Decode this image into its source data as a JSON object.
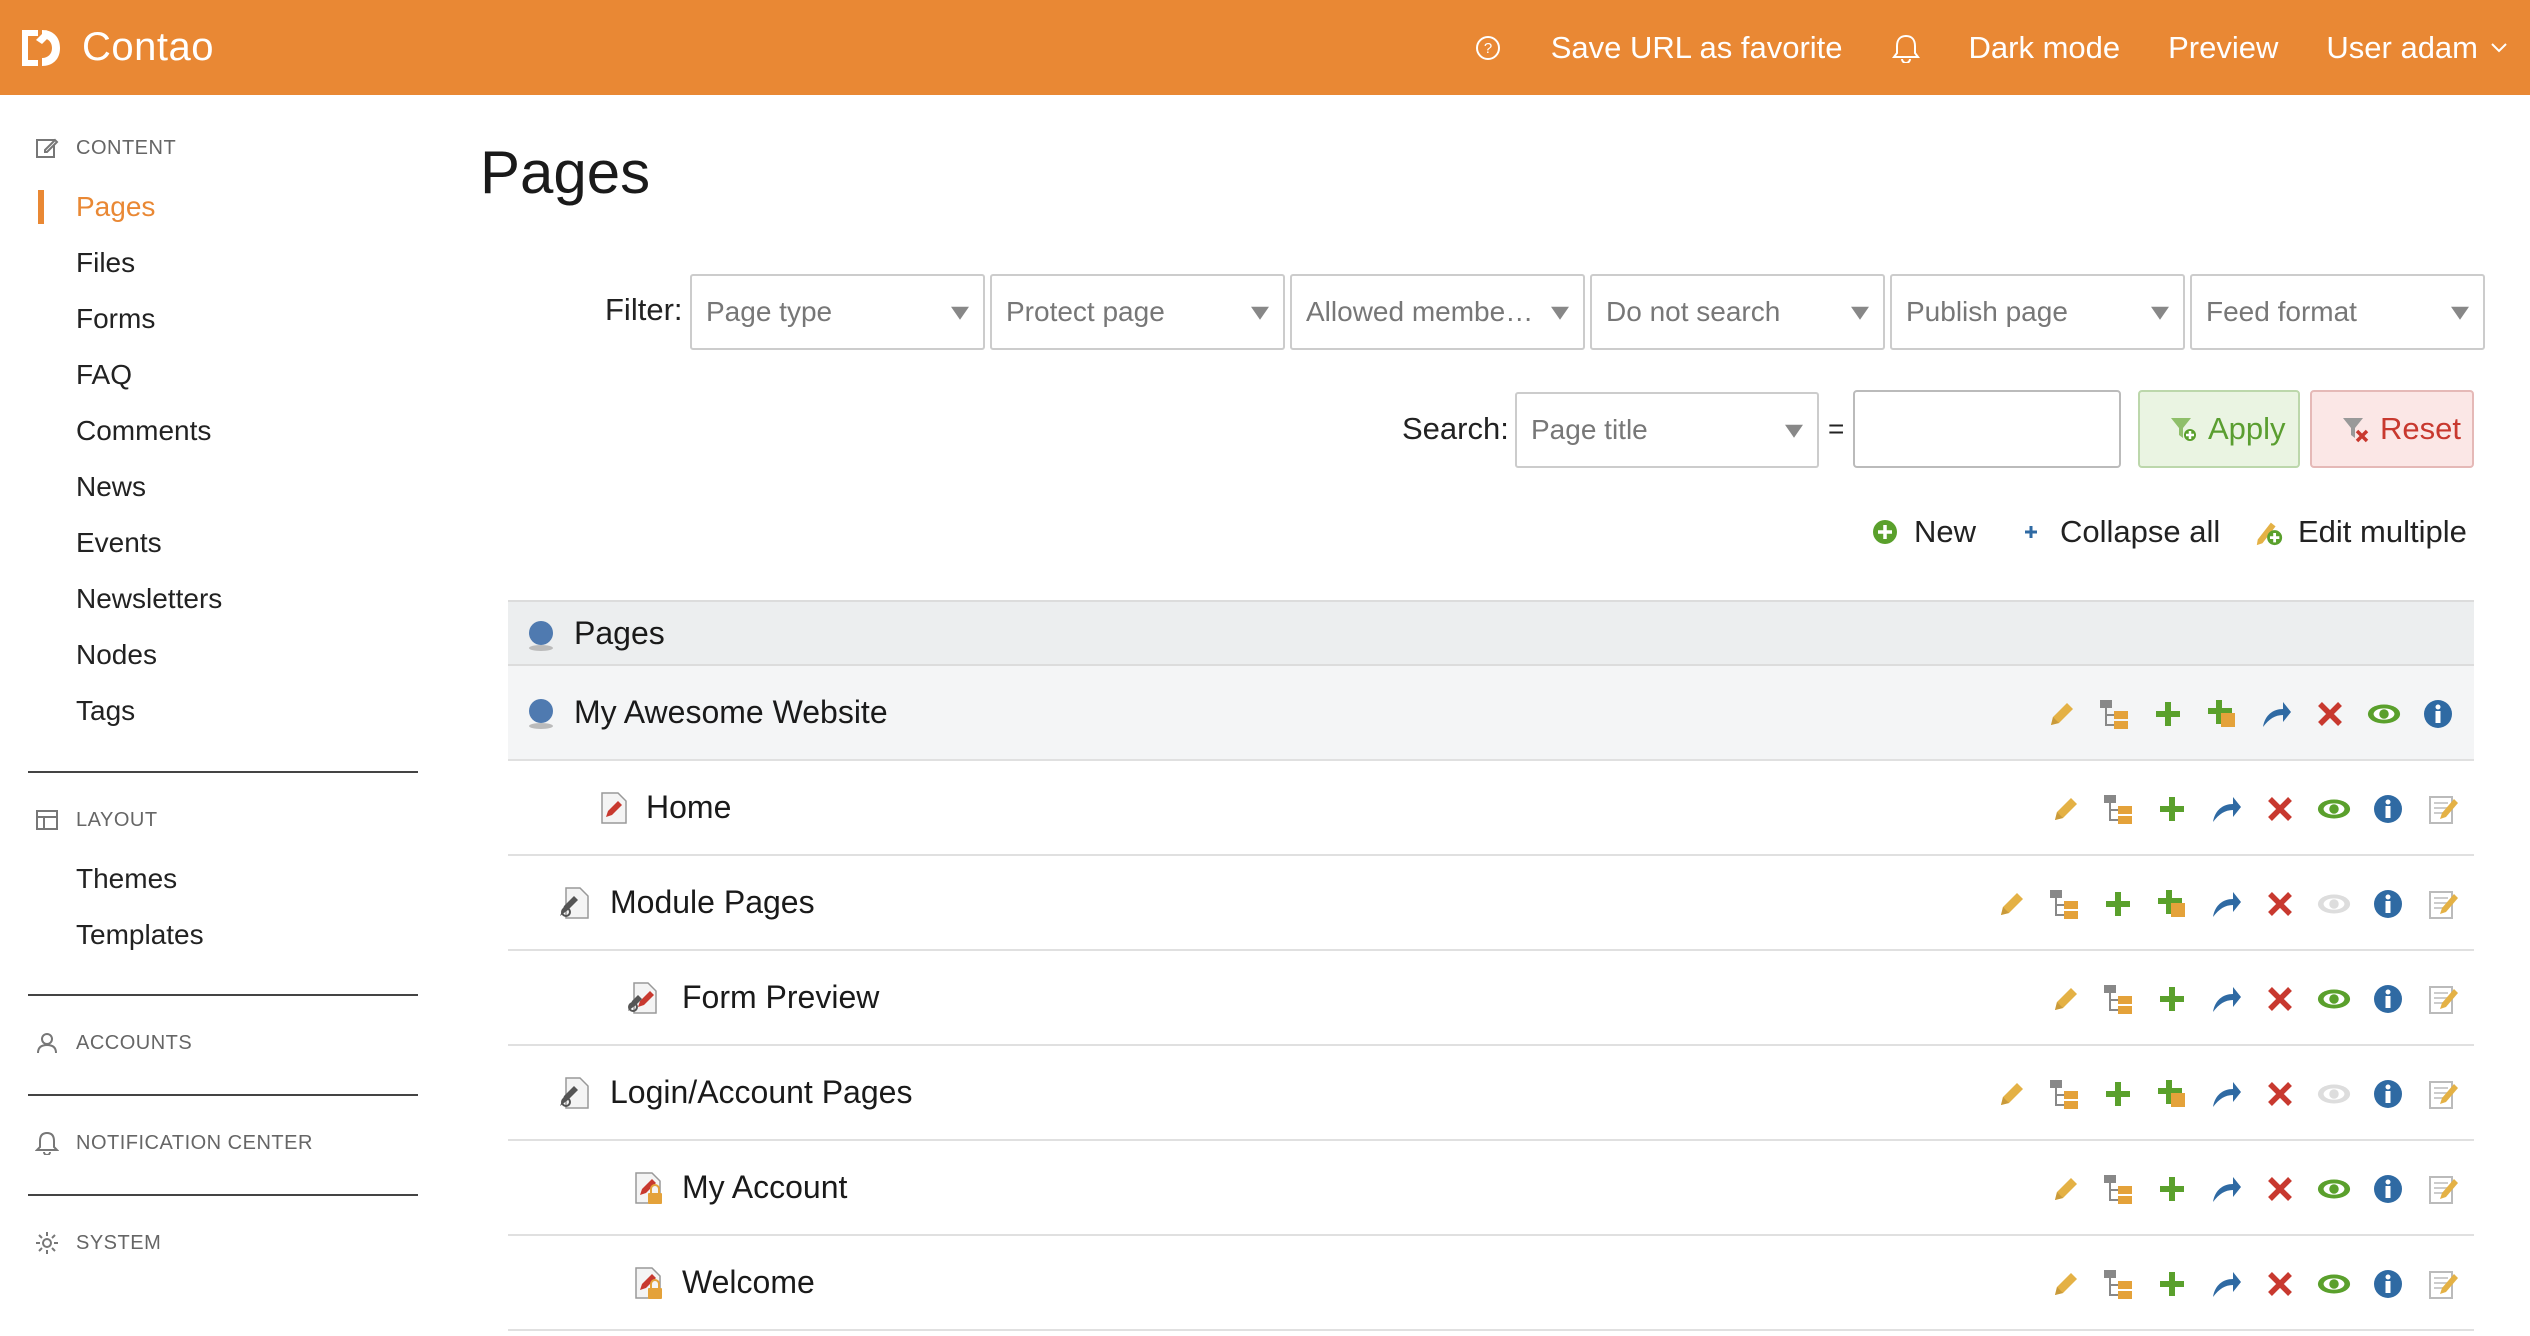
{
  "app": {
    "name": "Contao",
    "header": {
      "help_icon": "help-circle-icon",
      "favorite_label": "Save URL as favorite",
      "bell_icon": "bell-icon",
      "dark_mode_label": "Dark mode",
      "preview_label": "Preview",
      "user_label": "User adam"
    }
  },
  "sidebar": {
    "groups": [
      {
        "label": "CONTENT",
        "icon": "edit-icon",
        "items": [
          "Pages",
          "Files",
          "Forms",
          "FAQ",
          "Comments",
          "News",
          "Events",
          "Newsletters",
          "Nodes",
          "Tags"
        ],
        "active": "Pages"
      },
      {
        "label": "LAYOUT",
        "icon": "layout-icon",
        "items": [
          "Themes",
          "Templates"
        ]
      },
      {
        "label": "ACCOUNTS",
        "icon": "user-icon",
        "items": []
      },
      {
        "label": "NOTIFICATION CENTER",
        "icon": "bell-icon",
        "items": []
      },
      {
        "label": "SYSTEM",
        "icon": "gear-icon",
        "items": []
      }
    ]
  },
  "main": {
    "title": "Pages",
    "filter": {
      "label": "Filter:",
      "selects": [
        "Page type",
        "Protect page",
        "Allowed member…",
        "Do not search",
        "Publish page",
        "Feed format"
      ]
    },
    "search": {
      "label": "Search:",
      "field": "Page title",
      "equals": "=",
      "value": "",
      "apply_label": "Apply",
      "reset_label": "Reset"
    },
    "actions": {
      "new_label": "New",
      "collapse_label": "Collapse all",
      "edit_multiple_label": "Edit multiple"
    },
    "tree": {
      "header_label": "Pages",
      "rows": [
        {
          "label": "My Awesome Website",
          "type": "root",
          "published": true
        },
        {
          "label": "Home",
          "type": "regular",
          "published": true
        },
        {
          "label": "Module Pages",
          "type": "folder",
          "published": false
        },
        {
          "label": "Form Preview",
          "type": "regular",
          "published": true
        },
        {
          "label": "Login/Account Pages",
          "type": "folder",
          "published": false
        },
        {
          "label": "My Account",
          "type": "protected",
          "published": true
        },
        {
          "label": "Welcome",
          "type": "protected",
          "published": true
        }
      ]
    }
  },
  "colors": {
    "brand": "#e98834",
    "green": "#5aa02c",
    "red": "#c8392f",
    "blue": "#2f6aa3",
    "pencil": "#e4b145"
  }
}
